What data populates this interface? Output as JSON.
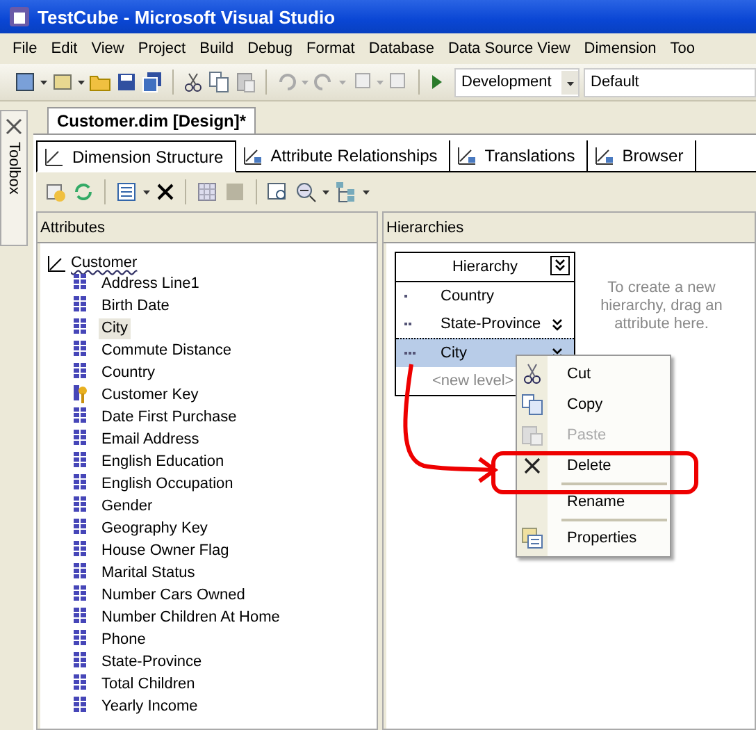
{
  "window": {
    "title": "TestCube - Microsoft Visual Studio"
  },
  "menu": [
    "File",
    "Edit",
    "View",
    "Project",
    "Build",
    "Debug",
    "Format",
    "Database",
    "Data Source View",
    "Dimension",
    "Too"
  ],
  "toolbar": {
    "configuration": "Development",
    "platform": "Default"
  },
  "toolbox": {
    "label": "Toolbox"
  },
  "document_tab": {
    "label": "Customer.dim [Design]*"
  },
  "tabs": [
    {
      "label": "Dimension Structure",
      "selected": true
    },
    {
      "label": "Attribute Relationships",
      "selected": false
    },
    {
      "label": "Translations",
      "selected": false
    },
    {
      "label": "Browser",
      "selected": false
    }
  ],
  "attributes": {
    "title": "Attributes",
    "root": "Customer",
    "items": [
      {
        "label": "Address Line1",
        "kind": "attribute",
        "selected": false
      },
      {
        "label": "Birth Date",
        "kind": "attribute",
        "selected": false
      },
      {
        "label": "City",
        "kind": "attribute",
        "selected": true
      },
      {
        "label": "Commute Distance",
        "kind": "attribute",
        "selected": false
      },
      {
        "label": "Country",
        "kind": "attribute",
        "selected": false
      },
      {
        "label": "Customer Key",
        "kind": "key",
        "selected": false
      },
      {
        "label": "Date First Purchase",
        "kind": "attribute",
        "selected": false
      },
      {
        "label": "Email Address",
        "kind": "attribute",
        "selected": false
      },
      {
        "label": "English Education",
        "kind": "attribute",
        "selected": false
      },
      {
        "label": "English Occupation",
        "kind": "attribute",
        "selected": false
      },
      {
        "label": "Gender",
        "kind": "attribute",
        "selected": false
      },
      {
        "label": "Geography Key",
        "kind": "attribute",
        "selected": false
      },
      {
        "label": "House Owner Flag",
        "kind": "attribute",
        "selected": false
      },
      {
        "label": "Marital Status",
        "kind": "attribute",
        "selected": false
      },
      {
        "label": "Number Cars Owned",
        "kind": "attribute",
        "selected": false
      },
      {
        "label": "Number Children At Home",
        "kind": "attribute",
        "selected": false
      },
      {
        "label": "Phone",
        "kind": "attribute",
        "selected": false
      },
      {
        "label": "State-Province",
        "kind": "attribute",
        "selected": false
      },
      {
        "label": "Total Children",
        "kind": "attribute",
        "selected": false
      },
      {
        "label": "Yearly Income",
        "kind": "attribute",
        "selected": false
      }
    ]
  },
  "hierarchies": {
    "title": "Hierarchies",
    "hint": "To create a new hierarchy, drag an attribute here.",
    "hierarchy": {
      "title": "Hierarchy",
      "levels": [
        {
          "label": "Country",
          "selected": false
        },
        {
          "label": "State-Province",
          "selected": false
        },
        {
          "label": "City",
          "selected": true
        }
      ],
      "new_level": "<new level>"
    }
  },
  "context_menu": [
    {
      "label": "Cut",
      "kind": "cut",
      "disabled": false,
      "separator_before": false
    },
    {
      "label": "Copy",
      "kind": "copy",
      "disabled": false,
      "separator_before": false
    },
    {
      "label": "Paste",
      "kind": "paste",
      "disabled": true,
      "separator_before": false
    },
    {
      "label": "Delete",
      "kind": "delete",
      "disabled": false,
      "separator_before": false
    },
    {
      "label": "Rename",
      "kind": "none",
      "disabled": false,
      "separator_before": true
    },
    {
      "label": "Properties",
      "kind": "properties",
      "disabled": false,
      "separator_before": true
    }
  ]
}
